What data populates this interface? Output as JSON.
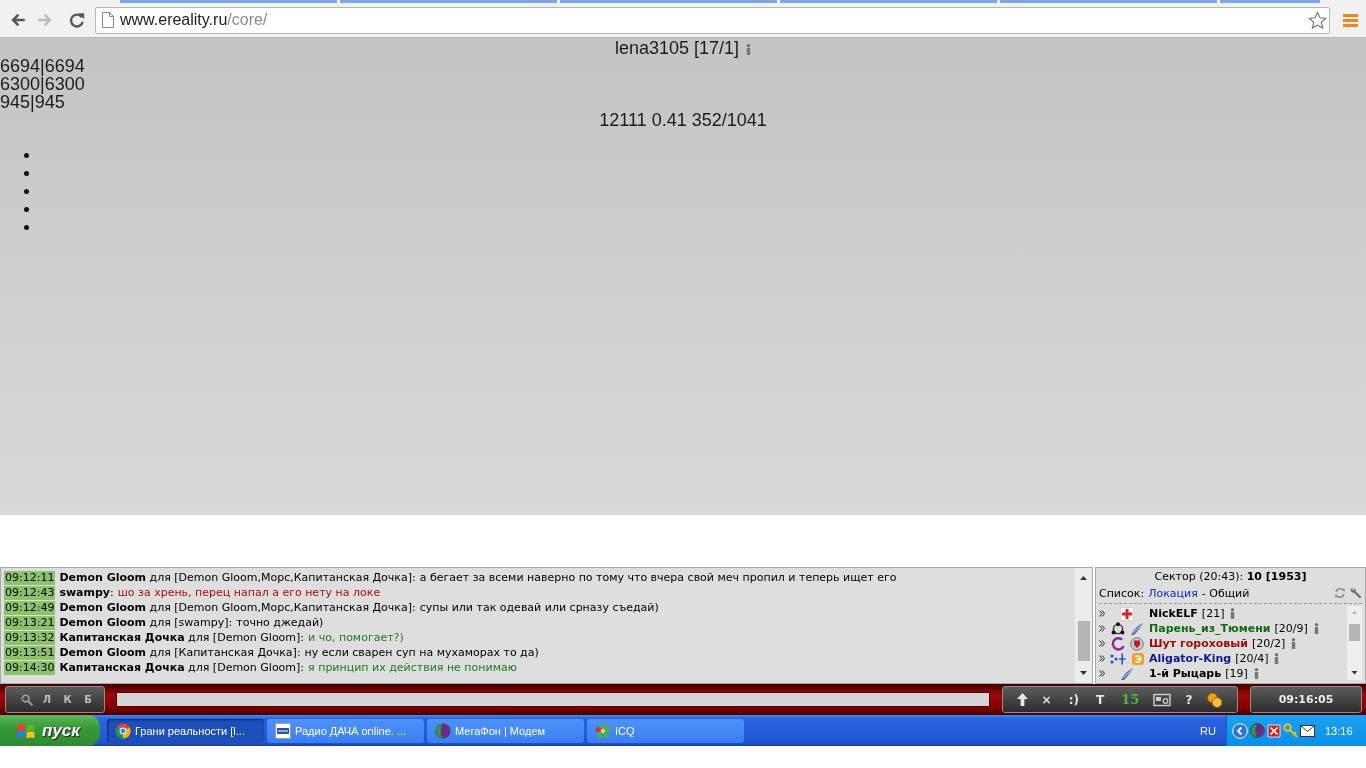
{
  "browser": {
    "back": {
      "disabled": false
    },
    "forward": {
      "disabled": true
    },
    "address": {
      "host": "www.ereality.ru",
      "path": "/core/"
    }
  },
  "page": {
    "player": "lena3105 [17/1]",
    "stats": [
      "6694|6694",
      "6300|6300",
      "945|945"
    ],
    "summary": "12111 0.41 352/1041",
    "list_items": [
      {
        "kind": "bullet"
      },
      {
        "kind": "bullet"
      },
      {
        "kind": "bullet"
      },
      {
        "kind": "bullet"
      },
      {
        "kind": "bullet"
      }
    ]
  },
  "chat": {
    "messages": [
      {
        "time": "09:12:11",
        "sender": "**Demon Gloom** для [Demon Gloom,Морс,Капитанская Дочка]:",
        "text": "а бегает за всеми наверно по тому что вчера свой меч пропил и теперь ищет его",
        "color": "#000000"
      },
      {
        "time": "09:12:43",
        "sender": "**swampy**:",
        "text": "шо за хрень, перец напал а его нету на локе",
        "color": "#a01010"
      },
      {
        "time": "09:12:49",
        "sender": "**Demon Gloom** для [Demon Gloom,Морс,Капитанская Дочка]:",
        "text": "супы или так одевай или срназу съедай)",
        "color": "#000000"
      },
      {
        "time": "09:13:21",
        "sender": "**Demon Gloom** для [swampy]:",
        "text": "точно джедай)",
        "color": "#000000"
      },
      {
        "time": "09:13:32",
        "sender": "**Капитанская Дочка** для [Demon Gloom]:",
        "text": "и чо, помогает?)",
        "color": "#1f7a1f"
      },
      {
        "time": "09:13:51",
        "sender": "**Demon Gloom** для [Капитанская Дочка]:",
        "text": "ну если сварен суп на мухаморах то да)",
        "color": "#000000"
      },
      {
        "time": "09:14:30",
        "sender": "**Капитанская Дочка** для [Demon Gloom]:",
        "text": "я принцип их действия не понимаю",
        "color": "#1f7a1f"
      }
    ]
  },
  "sector": {
    "title": "Сектор (20:43): **10 [1953]**",
    "list_label": "Список:",
    "list_link": "Локация",
    "list_filter": "- Общий",
    "players": [
      {
        "name": "NickELF",
        "rank": "[21]",
        "color": "#000000",
        "badges": [
          {
            "kind": "cross"
          }
        ]
      },
      {
        "name": "Парень_из_Тюмени",
        "rank": "[20/9]",
        "color": "#126b12",
        "badges": [
          {
            "kind": "ring"
          },
          {
            "kind": "feather"
          }
        ]
      },
      {
        "name": "Шут гороховый",
        "rank": "[20/2]",
        "color": "#9a0b0b",
        "badges": [
          {
            "kind": "crescent"
          },
          {
            "kind": "shield"
          }
        ]
      },
      {
        "name": "Aligator-King",
        "rank": "[20/4]",
        "color": "#0d1b8a",
        "badges": [
          {
            "kind": "dots"
          },
          {
            "kind": "coin"
          }
        ]
      },
      {
        "name": "1-й Рыцарь",
        "rank": "[19]",
        "color": "#000000",
        "badges": [
          {
            "kind": "feather"
          }
        ]
      }
    ]
  },
  "input_bar": {
    "left_tools": [
      {
        "kind": "search"
      },
      {
        "kind": "text",
        "label": "Л"
      },
      {
        "kind": "text",
        "label": "К"
      },
      {
        "kind": "text",
        "label": "Б"
      }
    ],
    "right_tools": [
      {
        "kind": "up"
      },
      {
        "kind": "text",
        "label": "×"
      },
      {
        "kind": "text",
        "label": ":)"
      },
      {
        "kind": "text",
        "label": "T"
      },
      {
        "kind": "counter",
        "label": "15"
      },
      {
        "kind": "photo"
      },
      {
        "kind": "text",
        "label": "?"
      },
      {
        "kind": "coins"
      }
    ],
    "clock": "09:16:05"
  },
  "taskbar": {
    "start": "пуск",
    "tasks": [
      {
        "label": "Грани реальности [l...",
        "kind": "chrome",
        "selected": true
      },
      {
        "label": "Радио ДАЧА online. ...",
        "kind": "radio",
        "selected": false
      },
      {
        "label": "МегаФон | Модем",
        "kind": "globe",
        "selected": false
      },
      {
        "label": "ICQ",
        "kind": "flower",
        "selected": false
      }
    ],
    "language": "RU",
    "clock": "13:16"
  }
}
